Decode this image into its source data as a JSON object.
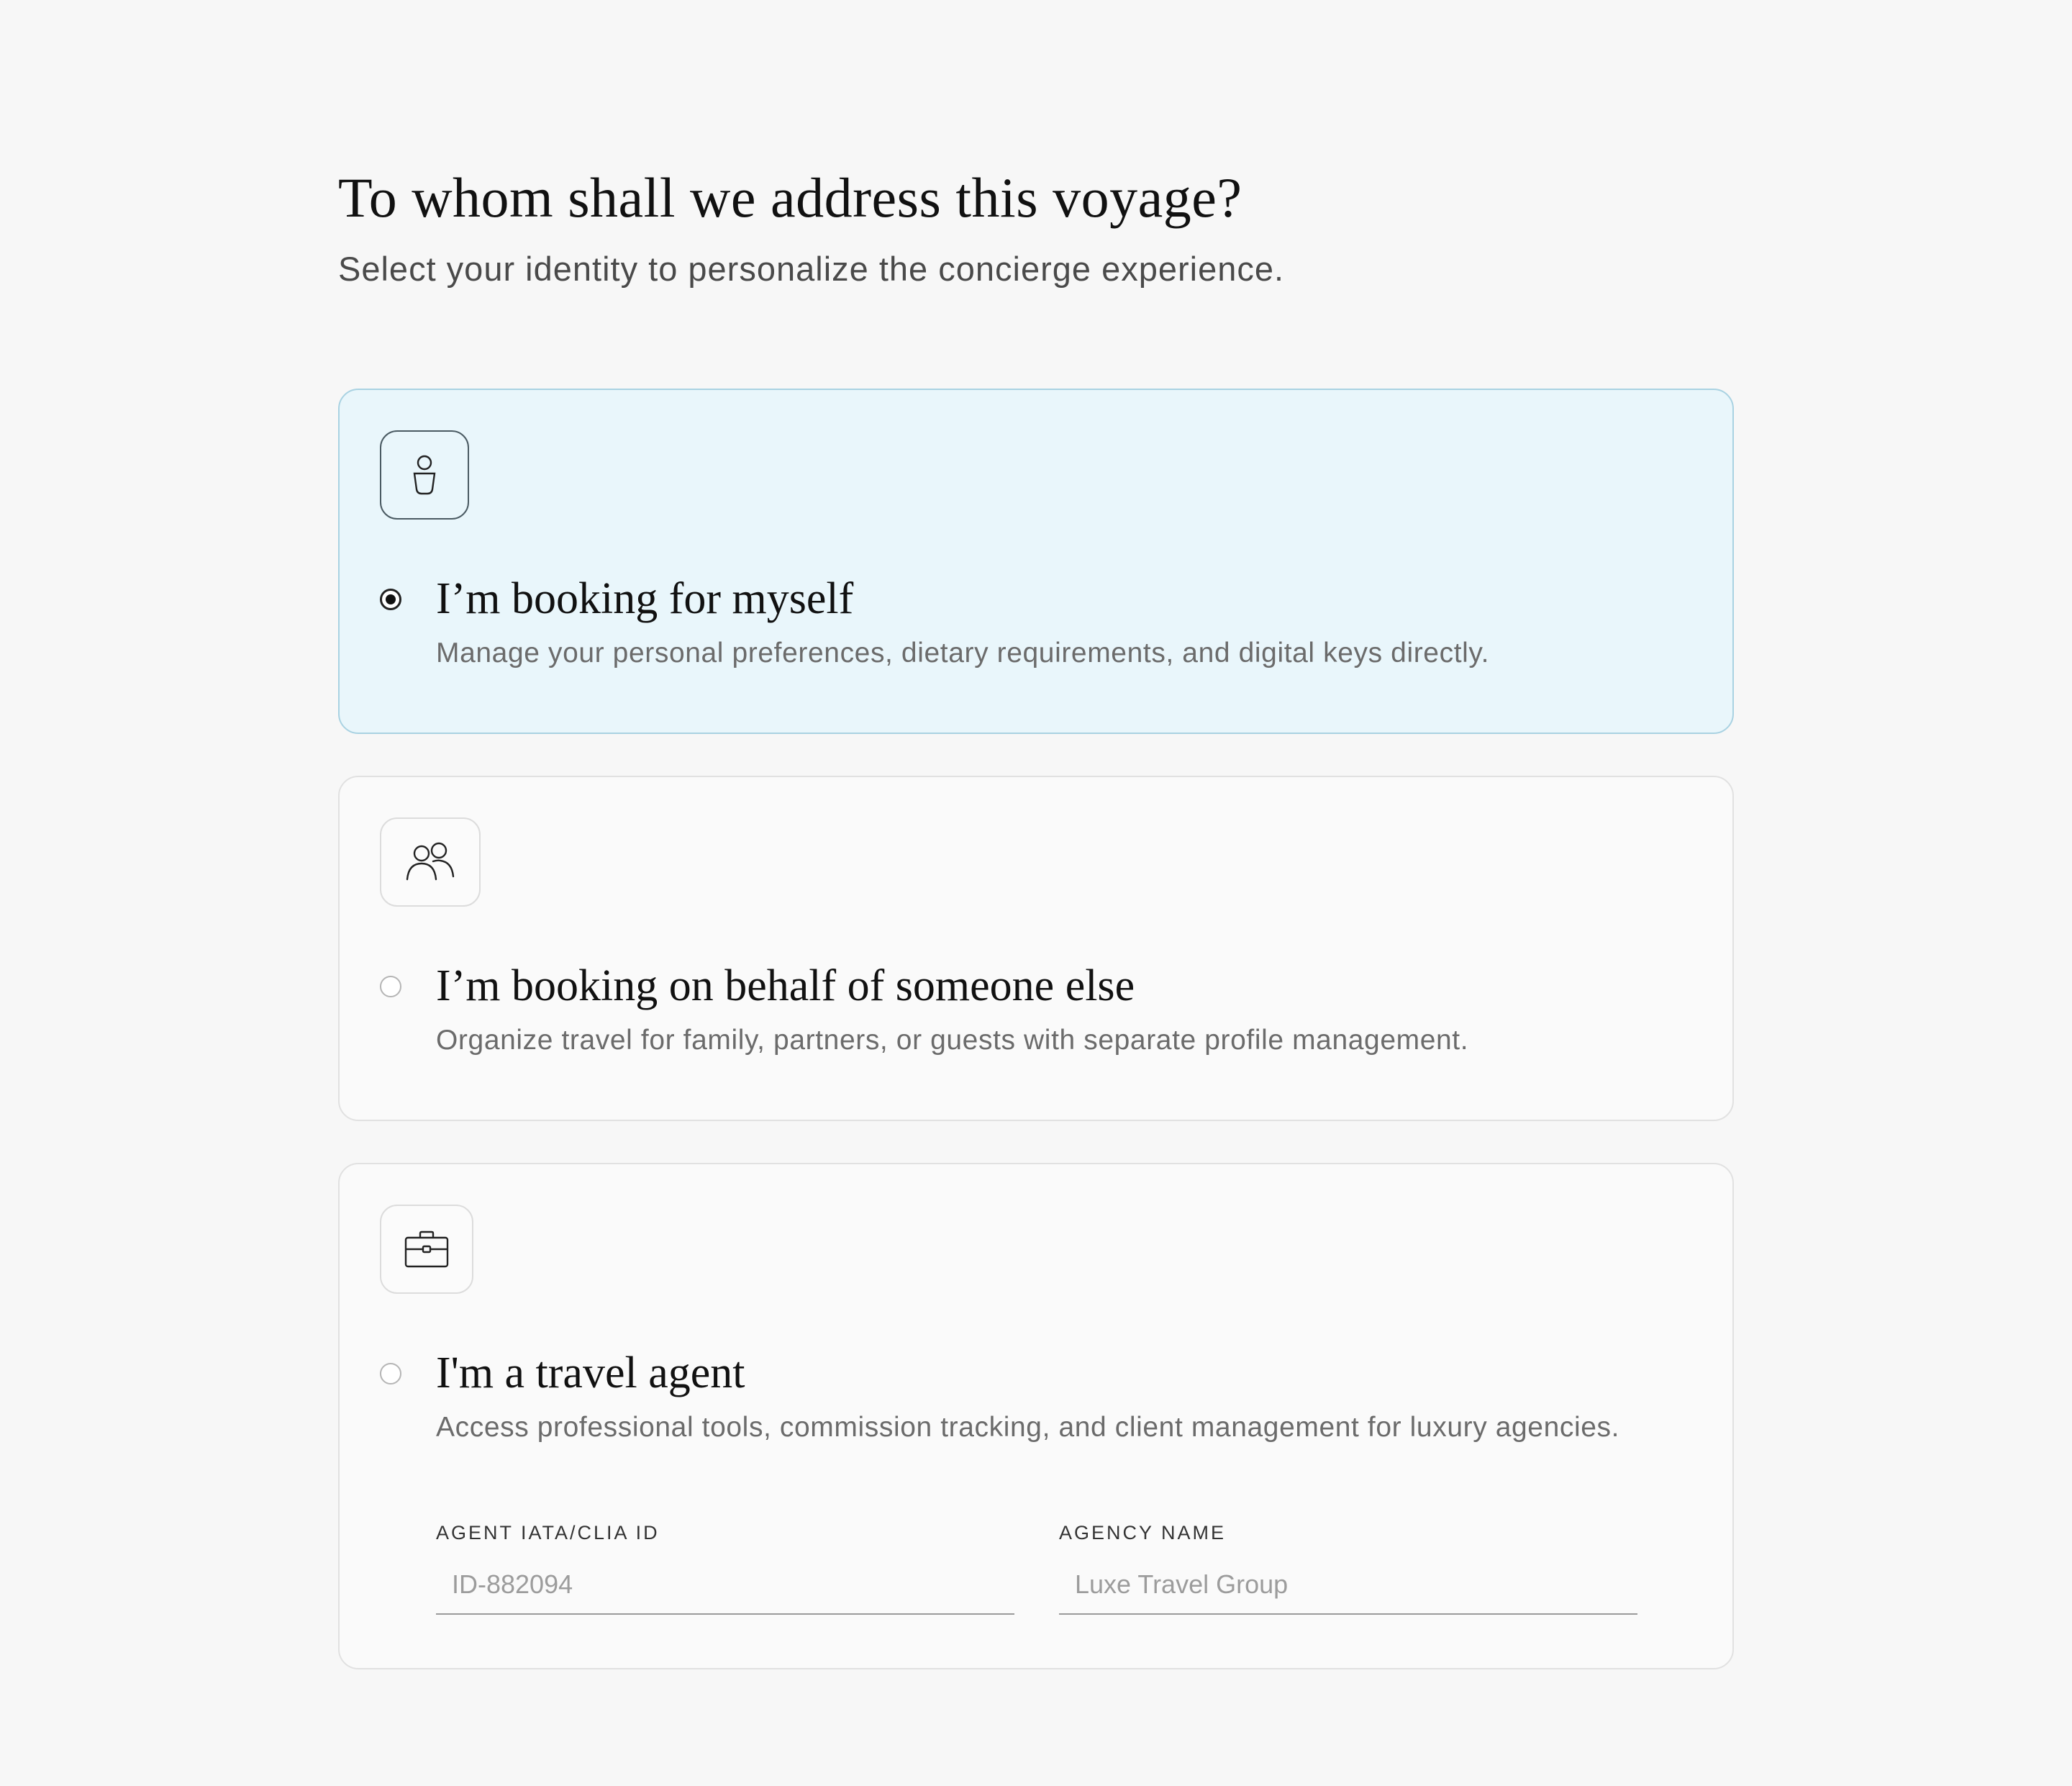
{
  "header": {
    "title": "To whom shall we address this voyage?",
    "subtitle": "Select your identity to personalize the concierge experience."
  },
  "options": [
    {
      "id": "myself",
      "icon": "person-icon",
      "title": "I’m booking for myself",
      "description": "Manage your personal preferences, dietary requirements, and digital keys directly.",
      "selected": true
    },
    {
      "id": "someone-else",
      "icon": "people-icon",
      "title": "I’m booking on behalf of someone else",
      "description": "Organize travel for family, partners, or guests with separate profile management.",
      "selected": false
    },
    {
      "id": "travel-agent",
      "icon": "briefcase-icon",
      "title": "I'm a travel agent",
      "description": "Access professional tools, commission tracking, and client management for luxury agencies.",
      "selected": false
    }
  ],
  "agent_fields": {
    "agent_id": {
      "label": "AGENT IATA/CLIA ID",
      "value": "",
      "placeholder": "ID-882094"
    },
    "agency_name": {
      "label": "AGENCY NAME",
      "value": "",
      "placeholder": "Luxe Travel Group"
    }
  },
  "colors": {
    "background": "#f7f7f7",
    "selected_card_bg": "#e9f6fb",
    "selected_card_border": "#a9d2e2",
    "card_border": "#e1e1e1",
    "text_primary": "#111111",
    "text_secondary": "#6b6b6b"
  }
}
